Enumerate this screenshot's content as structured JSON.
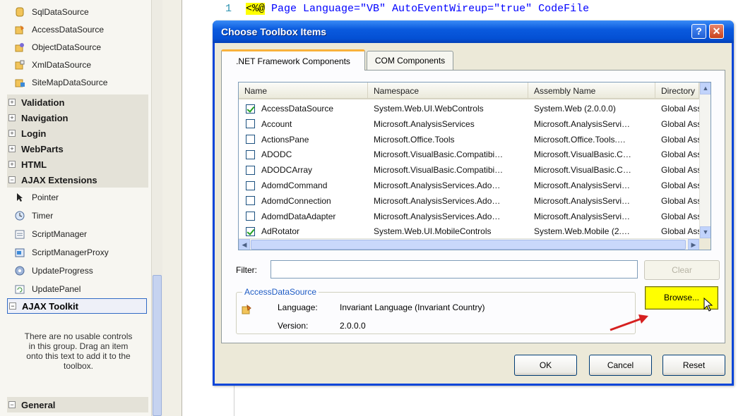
{
  "toolbox": {
    "items_top": [
      {
        "label": "SqlDataSource",
        "icon": "sql-datasource-icon"
      },
      {
        "label": "AccessDataSource",
        "icon": "access-datasource-icon"
      },
      {
        "label": "ObjectDataSource",
        "icon": "object-datasource-icon"
      },
      {
        "label": "XmlDataSource",
        "icon": "xml-datasource-icon"
      },
      {
        "label": "SiteMapDataSource",
        "icon": "sitemap-datasource-icon"
      }
    ],
    "groups": [
      {
        "label": "Validation",
        "sign": "+"
      },
      {
        "label": "Navigation",
        "sign": "+"
      },
      {
        "label": "Login",
        "sign": "+"
      },
      {
        "label": "WebParts",
        "sign": "+"
      },
      {
        "label": "HTML",
        "sign": "+"
      },
      {
        "label": "AJAX Extensions",
        "sign": "−"
      }
    ],
    "ajax_items": [
      {
        "label": "Pointer",
        "icon": "pointer-icon"
      },
      {
        "label": "Timer",
        "icon": "timer-icon"
      },
      {
        "label": "ScriptManager",
        "icon": "scriptmanager-icon"
      },
      {
        "label": "ScriptManagerProxy",
        "icon": "scriptmanagerproxy-icon"
      },
      {
        "label": "UpdateProgress",
        "icon": "updateprogress-icon"
      },
      {
        "label": "UpdatePanel",
        "icon": "updatepanel-icon"
      }
    ],
    "ajax_toolkit": {
      "label": "AJAX Toolkit",
      "sign": "−"
    },
    "empty_message": "There are no usable controls in this group. Drag an item onto this text to add it to the toolbox.",
    "general": {
      "label": "General",
      "sign": "−"
    }
  },
  "editor": {
    "line_number": "1",
    "directive": "<%@",
    "code": " Page Language=\"VB\" AutoEventWireup=\"true\" CodeFile"
  },
  "dialog": {
    "title": "Choose Toolbox Items",
    "help_label": "?",
    "close_label": "✕",
    "tabs": [
      ".NET Framework Components",
      "COM Components"
    ],
    "columns": [
      "Name",
      "Namespace",
      "Assembly Name",
      "Directory"
    ],
    "rows": [
      {
        "checked": true,
        "name": "AccessDataSource",
        "namespace": "System.Web.UI.WebControls",
        "assembly": "System.Web (2.0.0.0)",
        "directory": "Global Ass"
      },
      {
        "checked": false,
        "name": "Account",
        "namespace": "Microsoft.AnalysisServices",
        "assembly": "Microsoft.AnalysisServi…",
        "directory": "Global Ass"
      },
      {
        "checked": false,
        "name": "ActionsPane",
        "namespace": "Microsoft.Office.Tools",
        "assembly": "Microsoft.Office.Tools.…",
        "directory": "Global Ass"
      },
      {
        "checked": false,
        "name": "ADODC",
        "namespace": "Microsoft.VisualBasic.Compatibi…",
        "assembly": "Microsoft.VisualBasic.C…",
        "directory": "Global Ass"
      },
      {
        "checked": false,
        "name": "ADODCArray",
        "namespace": "Microsoft.VisualBasic.Compatibi…",
        "assembly": "Microsoft.VisualBasic.C…",
        "directory": "Global Ass"
      },
      {
        "checked": false,
        "name": "AdomdCommand",
        "namespace": "Microsoft.AnalysisServices.Ado…",
        "assembly": "Microsoft.AnalysisServi…",
        "directory": "Global Ass"
      },
      {
        "checked": false,
        "name": "AdomdConnection",
        "namespace": "Microsoft.AnalysisServices.Ado…",
        "assembly": "Microsoft.AnalysisServi…",
        "directory": "Global Ass"
      },
      {
        "checked": false,
        "name": "AdomdDataAdapter",
        "namespace": "Microsoft.AnalysisServices.Ado…",
        "assembly": "Microsoft.AnalysisServi…",
        "directory": "Global Ass"
      },
      {
        "checked": true,
        "name": "AdRotator",
        "namespace": "System.Web.UI.MobileControls",
        "assembly": "System.Web.Mobile (2.…",
        "directory": "Global Ass"
      }
    ],
    "filter_label": "Filter:",
    "filter_value": "",
    "clear_label": "Clear",
    "group_title": "AccessDataSource",
    "language_label": "Language:",
    "language_value": "Invariant Language (Invariant Country)",
    "version_label": "Version:",
    "version_value": "2.0.0.0",
    "browse_label": "Browse...",
    "ok_label": "OK",
    "cancel_label": "Cancel",
    "reset_label": "Reset"
  },
  "colors": {
    "titlebar": "#0450d4",
    "browse_highlight": "#ffff00",
    "annotation_arrow": "#d62020",
    "group_title": "#1f5cc4"
  }
}
